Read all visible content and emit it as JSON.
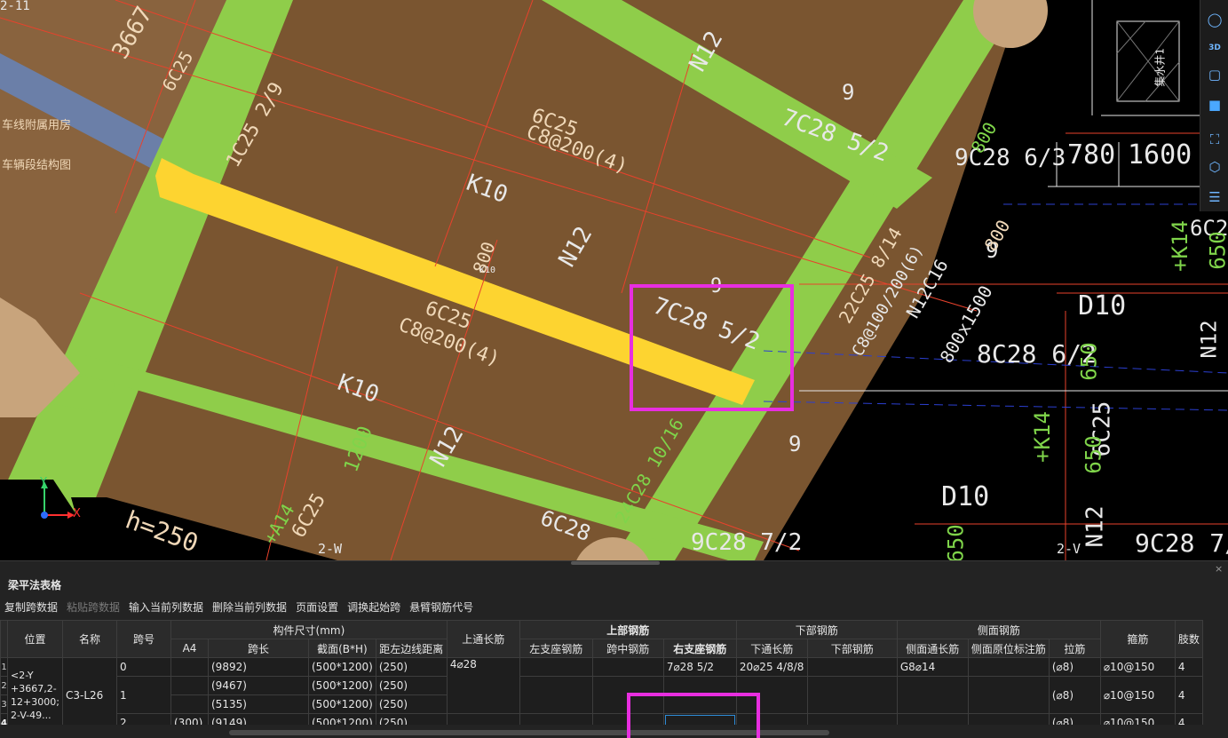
{
  "cad": {
    "texts": [
      {
        "id": "t1",
        "text": "2-11"
      },
      {
        "id": "t2",
        "text": "3667"
      },
      {
        "id": "t3",
        "text": "6C25"
      },
      {
        "id": "t4",
        "text": "1C25 2/9"
      },
      {
        "id": "t5",
        "text": "K10"
      },
      {
        "id": "t6",
        "text": "N12"
      },
      {
        "id": "t7",
        "text": "6C25"
      },
      {
        "id": "t8",
        "text": "C8@200(4)"
      },
      {
        "id": "t9",
        "text": "7C28 5/2"
      },
      {
        "id": "t10",
        "text": "9"
      },
      {
        "id": "t11",
        "text": "9C28 6/3"
      },
      {
        "id": "t12",
        "text": "780"
      },
      {
        "id": "t13",
        "text": "1600"
      },
      {
        "id": "t14",
        "text": "N12"
      },
      {
        "id": "t15",
        "text": "800"
      },
      {
        "id": "t16",
        "text": "6C25"
      },
      {
        "id": "t17",
        "text": "C8@200(4)"
      },
      {
        "id": "t18",
        "text": "7C28 5/2"
      },
      {
        "id": "t19",
        "text": "9"
      },
      {
        "id": "t20",
        "text": "8C28 6/2"
      },
      {
        "id": "t21",
        "text": "D10"
      },
      {
        "id": "t22",
        "text": "650"
      },
      {
        "id": "t23",
        "text": "K10"
      },
      {
        "id": "t24",
        "text": "1200"
      },
      {
        "id": "t25",
        "text": "N12"
      },
      {
        "id": "t26",
        "text": "9"
      },
      {
        "id": "t27",
        "text": "6C25"
      },
      {
        "id": "t28",
        "text": "650"
      },
      {
        "id": "t29",
        "text": "D10"
      },
      {
        "id": "t30",
        "text": "h=250"
      },
      {
        "id": "t31",
        "text": "6C25"
      },
      {
        "id": "t32",
        "text": "6C28"
      },
      {
        "id": "t33",
        "text": "9C28 7/2"
      },
      {
        "id": "t34",
        "text": "9C28 7/2"
      },
      {
        "id": "t35",
        "text": "2-W"
      },
      {
        "id": "t36",
        "text": "2-V"
      },
      {
        "id": "t37",
        "text": "N12"
      },
      {
        "id": "t38",
        "text": "650"
      },
      {
        "id": "t39",
        "text": "+K14"
      },
      {
        "id": "t40",
        "text": "+K14"
      },
      {
        "id": "t41",
        "text": "6C25"
      },
      {
        "id": "t42",
        "text": "650"
      },
      {
        "id": "t43",
        "text": "N12C16"
      },
      {
        "id": "t44",
        "text": "800x1500"
      },
      {
        "id": "t45",
        "text": "C8@100/200(6)"
      },
      {
        "id": "t46",
        "text": "22C25 8/14"
      },
      {
        "id": "t47",
        "text": "24C28 10/16"
      },
      {
        "id": "t48",
        "text": "800"
      },
      {
        "id": "t49",
        "text": "车线附属用房"
      },
      {
        "id": "t50",
        "text": "车辆段结构图"
      },
      {
        "id": "t51",
        "text": "集水井1"
      },
      {
        "id": "t52",
        "text": "N12"
      },
      {
        "id": "t53",
        "text": "9"
      },
      {
        "id": "t54",
        "text": "+A14"
      },
      {
        "id": "t55",
        "text": "800"
      },
      {
        "id": "t56",
        "text": "K10"
      }
    ],
    "axis": {
      "x": "X",
      "y": "Y"
    }
  },
  "toolbar": {
    "icons": [
      "sphere-icon",
      "3d-view-icon",
      "cube-icon",
      "cube-blue-icon",
      "fit-view-icon",
      "view-cube-icon",
      "property-list-icon"
    ],
    "label_3d": "3D"
  },
  "panel": {
    "title": "梁平法表格",
    "close": "×",
    "menu": [
      {
        "label": "复制跨数据",
        "disabled": false
      },
      {
        "label": "粘贴跨数据",
        "disabled": true
      },
      {
        "label": "输入当前列数据",
        "disabled": false
      },
      {
        "label": "删除当前列数据",
        "disabled": false
      },
      {
        "label": "页面设置",
        "disabled": false
      },
      {
        "label": "调换起始跨",
        "disabled": false
      },
      {
        "label": "悬臂钢筋代号",
        "disabled": false
      }
    ],
    "headers": {
      "position": "位置",
      "name": "名称",
      "span_no": "跨号",
      "dims_group": "构件尺寸(mm)",
      "a4": "A4",
      "span_len": "跨长",
      "section": "截面(B*H)",
      "left_offset": "距左边线距离",
      "top_through": "上通长筋",
      "top_group": "上部钢筋",
      "left_support": "左支座钢筋",
      "mid_span": "跨中钢筋",
      "right_support": "右支座钢筋",
      "bottom_group": "下部钢筋",
      "bottom_through": "下通长筋",
      "bottom_bar": "下部钢筋",
      "side_group": "侧面钢筋",
      "side_through": "侧面通长筋",
      "side_orig": "侧面原位标注筋",
      "tie": "拉筋",
      "stirrup": "箍筋",
      "legs": "肢数"
    },
    "position_text": "<2-Y +3667,2-12+3000;2-V-49...",
    "position_lines": [
      "<2-Y",
      "+3667,2-",
      "12+3000;",
      "2-V-49..."
    ],
    "name_text": "C3-L26",
    "row_numbers": [
      "1",
      "2",
      "3",
      "4"
    ],
    "rows": [
      {
        "span": "0",
        "a4": "",
        "len": "(9892)",
        "section": "(500*1200)",
        "offset": "(250)",
        "top_through": "4⌀28",
        "left": "",
        "mid": "",
        "right": "7⌀28 5/2",
        "bot_through": "20⌀25 4/8/8",
        "bot": "",
        "side_through": "G8⌀14",
        "side_orig": "",
        "tie": "(⌀8)",
        "stirrup": "⌀10@150",
        "legs": "4"
      },
      {
        "span": "1",
        "a4": "",
        "len": "(9467)",
        "section": "(500*1200)",
        "offset": "(250)",
        "top_through": "",
        "left": "",
        "mid": "",
        "right": "",
        "bot_through": "",
        "bot": "",
        "side_through": "",
        "side_orig": "",
        "tie": "(⌀8)",
        "stirrup": "⌀10@150",
        "legs": "4"
      },
      {
        "span": "",
        "a4": "",
        "len": "(5135)",
        "section": "(500*1200)",
        "offset": "(250)"
      },
      {
        "span": "2",
        "a4": "(300)",
        "len": "(9149)",
        "section": "(500*1200)",
        "offset": "(250)",
        "top_through": "",
        "left": "",
        "mid": "",
        "right": "",
        "bot_through": "",
        "bot": "",
        "side_through": "",
        "side_orig": "",
        "tie": "(⌀8)",
        "stirrup": "⌀10@150",
        "legs": "4"
      }
    ]
  }
}
